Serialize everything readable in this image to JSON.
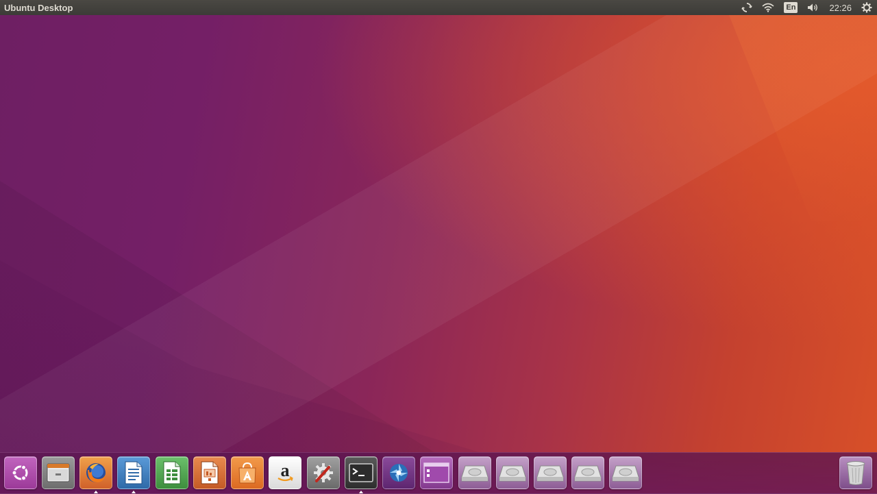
{
  "top_panel": {
    "title": "Ubuntu Desktop",
    "keyboard_layout": "En",
    "clock": "22:26",
    "indicators": [
      "sync-icon",
      "wifi-icon",
      "keyboard-layout",
      "volume-icon",
      "clock",
      "gear-icon"
    ]
  },
  "launcher": {
    "items": [
      {
        "name": "ubuntu-dash",
        "icon": "ubuntu-logo-icon",
        "color": "#b24fb0",
        "running": false
      },
      {
        "name": "files",
        "icon": "file-cabinet-icon",
        "color": "#8a8a8a",
        "running": false
      },
      {
        "name": "firefox",
        "icon": "firefox-icon",
        "color": "#e8833a",
        "running": true
      },
      {
        "name": "libreoffice-writer",
        "icon": "writer-icon",
        "color": "#3a7fc4",
        "running": true
      },
      {
        "name": "libreoffice-calc",
        "icon": "calc-icon",
        "color": "#4aa24a",
        "running": false
      },
      {
        "name": "libreoffice-impress",
        "icon": "impress-icon",
        "color": "#d6642e",
        "running": false
      },
      {
        "name": "software-center",
        "icon": "shopping-bag-icon",
        "color": "#ea7a2c",
        "running": false
      },
      {
        "name": "amazon",
        "icon": "amazon-icon",
        "color": "#f2f2f2",
        "running": false
      },
      {
        "name": "system-settings",
        "icon": "settings-tools-icon",
        "color": "#8c8c8c",
        "running": false
      },
      {
        "name": "terminal",
        "icon": "terminal-icon",
        "color": "#4a4a4a",
        "running": true
      },
      {
        "name": "shotwell",
        "icon": "aperture-icon",
        "color": "#7a3a8a",
        "running": false
      },
      {
        "name": "workspace-switcher",
        "icon": "workspace-icon",
        "color": "#9a4fa0",
        "running": false
      },
      {
        "name": "drive-1",
        "icon": "drive-icon",
        "color": "#a9a9a9",
        "running": false
      },
      {
        "name": "drive-2",
        "icon": "drive-icon",
        "color": "#a9a9a9",
        "running": false
      },
      {
        "name": "drive-3",
        "icon": "drive-icon",
        "color": "#a9a9a9",
        "running": false
      },
      {
        "name": "drive-4",
        "icon": "drive-icon",
        "color": "#a9a9a9",
        "running": false
      },
      {
        "name": "drive-5",
        "icon": "drive-icon",
        "color": "#a9a9a9",
        "running": false
      }
    ],
    "trash": {
      "name": "trash",
      "icon": "trash-icon"
    }
  }
}
